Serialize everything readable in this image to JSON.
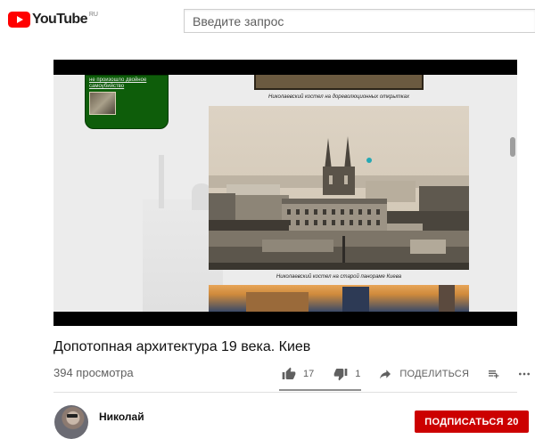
{
  "header": {
    "logo_text": "YouTube",
    "logo_region": "RU",
    "logo_color": "#ff0000",
    "search_placeholder": "Введите запрос"
  },
  "player": {
    "overlay_card_text": "не произошло двойное самоубийство",
    "caption_top": "Николаевский костел на дореволюционных открытках",
    "caption_bottom": "Николаевский костел на старой панораме Киева"
  },
  "video": {
    "title": "Допотопная архитектура 19 века. Киев",
    "views": "394 просмотра",
    "likes": "17",
    "dislikes": "1",
    "share_label": "ПОДЕЛИТЬСЯ",
    "like_ratio": 0.944
  },
  "channel": {
    "name": "Николай",
    "subscribe_label": "ПОДПИСАТЬСЯ",
    "subscriber_count": "20",
    "subscribe_color": "#cc0000"
  },
  "icons": {
    "logo": "youtube-play-icon",
    "like": "thumbs-up-icon",
    "dislike": "thumbs-down-icon",
    "share": "share-arrow-icon",
    "save": "add-to-playlist-icon",
    "more": "more-horizontal-icon"
  }
}
